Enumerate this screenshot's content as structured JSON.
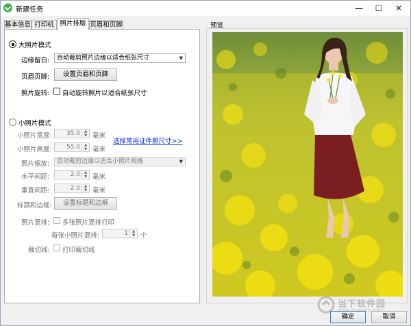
{
  "window": {
    "title": "新建任务",
    "minimize": "—",
    "maximize": "☐",
    "close": "✕"
  },
  "tabs": [
    "基本信息",
    "打印机",
    "照片排版",
    "页眉和页脚"
  ],
  "large_mode": {
    "label": "大照片模式",
    "selected": true,
    "margin_label": "边缘留白:",
    "margin_value": "自动裁剪照片边缘以适合纸张尺寸",
    "header_footer_label": "页眉页脚:",
    "header_footer_button": "设置页眉和页脚",
    "rotate_label": "照片旋转:",
    "rotate_checkbox": "自动旋转照片以适合纸张尺寸"
  },
  "small_mode": {
    "label": "小照片模式",
    "selected": false,
    "width_label": "小照片宽度:",
    "width_value": "35.0",
    "height_label": "小照片高度:",
    "height_value": "55.0",
    "unit": "毫米",
    "common_sizes_link": "选择常用证件照尺寸>>",
    "scale_label": "照片缩放:",
    "scale_value": "自动裁剪边缘以适合小照片规格",
    "h_spacing_label": "水平间距:",
    "h_spacing_value": "2.0",
    "v_spacing_label": "垂直间距:",
    "v_spacing_value": "2.0",
    "title_border_label": "标题和边框:",
    "title_border_button": "设置标题和边框",
    "mix_label": "照片混排:",
    "mix_checkbox": "多张照片混排打印",
    "per_mix_label": "每张小照片混排:",
    "per_mix_value": "1",
    "per_mix_unit": "个",
    "cut_label": "裁切线:",
    "cut_checkbox": "打印裁切线"
  },
  "preview": {
    "label": "预览"
  },
  "watermark": {
    "text": "当下软件园",
    "sub": "www.downxia.com"
  },
  "footer": {
    "ok": "确定",
    "cancel": "取消"
  }
}
